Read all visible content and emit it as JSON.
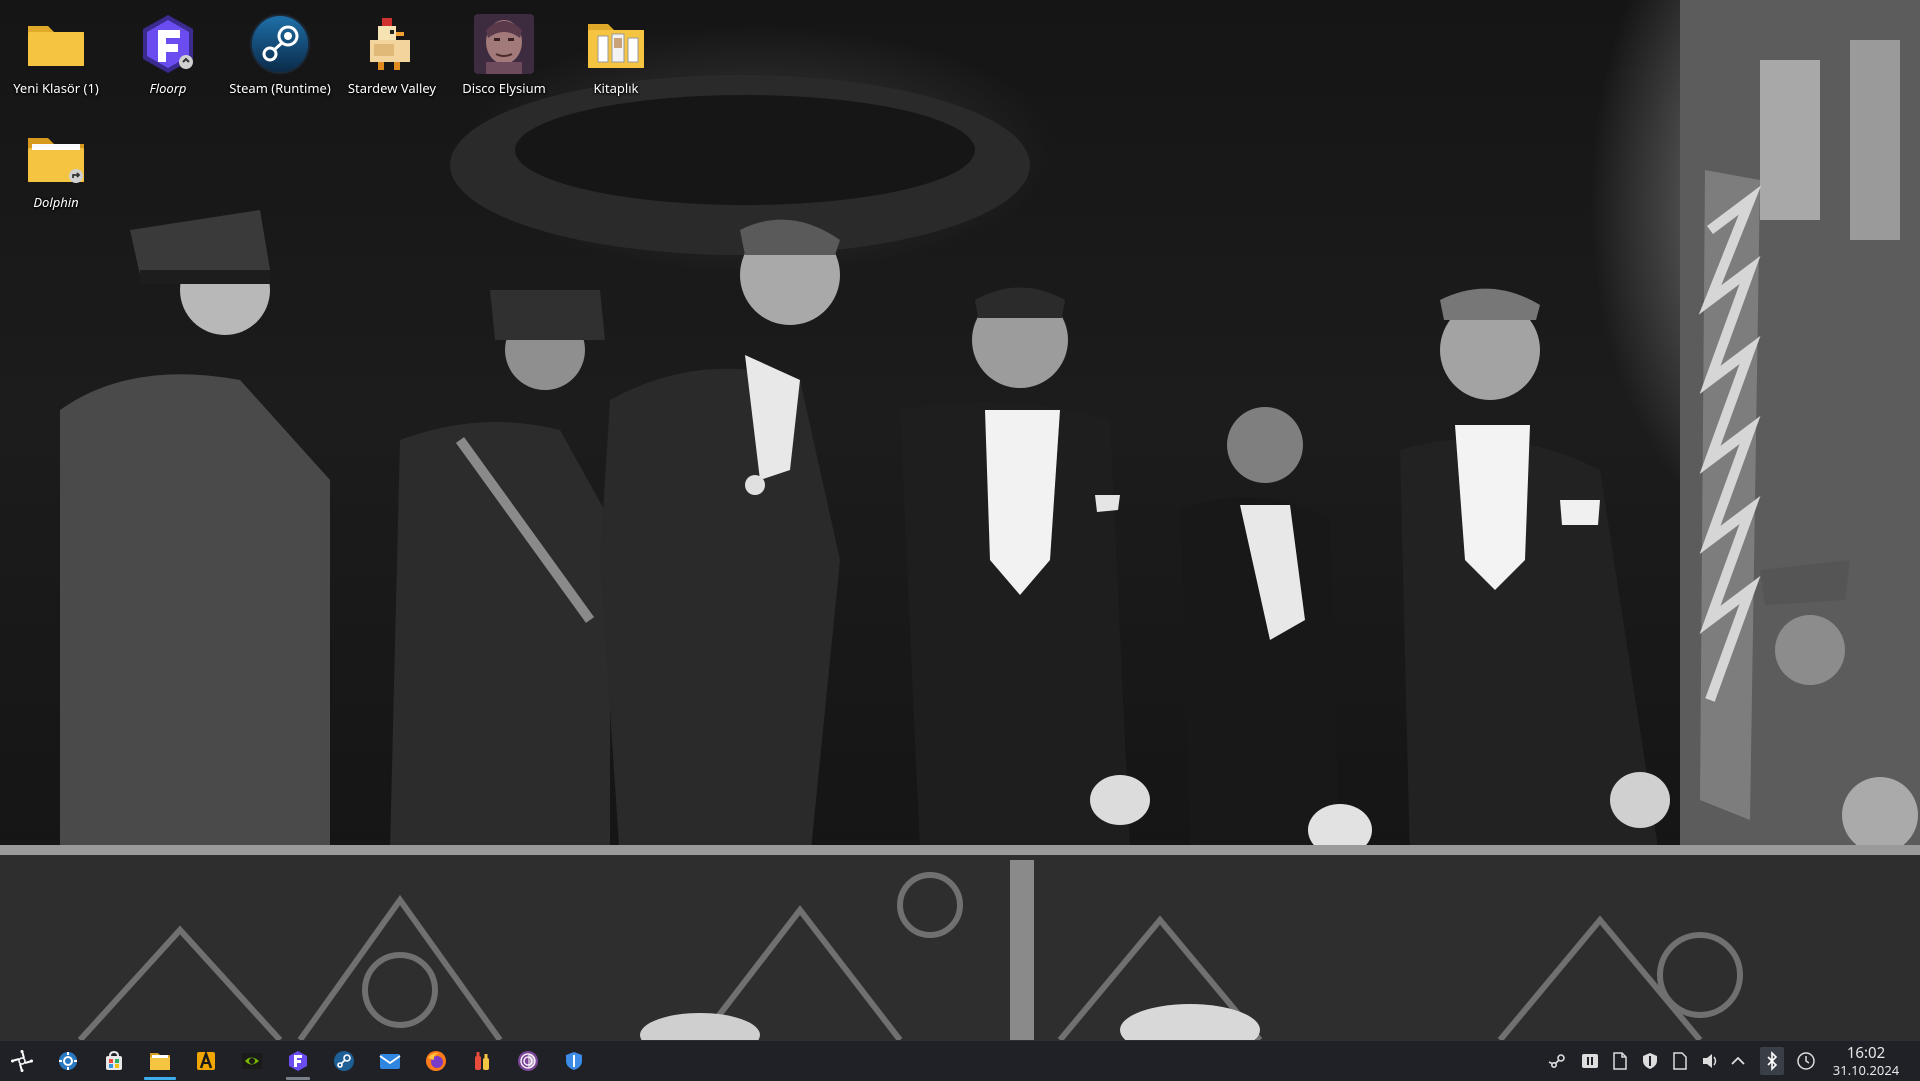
{
  "desktop": {
    "icons": [
      {
        "label": "Yeni Klasör (1)",
        "icon": "folder-icon"
      },
      {
        "label": "Floorp",
        "icon": "floorp-browser-icon"
      },
      {
        "label": "Steam (Runtime)",
        "icon": "steam-icon"
      },
      {
        "label": "Stardew Valley",
        "icon": "stardew-valley-chicken-icon"
      },
      {
        "label": "Disco Elysium",
        "icon": "disco-elysium-portrait-icon"
      },
      {
        "label": "Kitaplık",
        "icon": "library-folder-icon"
      },
      {
        "label": "Dolphin",
        "icon": "dolphin-folder-link-icon"
      }
    ]
  },
  "taskbar": {
    "launcher": {
      "icon": "kde-application-launcher-icon"
    },
    "pinned": [
      {
        "name": "System Settings",
        "icon": "system-settings-icon"
      },
      {
        "name": "Discover",
        "icon": "discover-store-icon"
      },
      {
        "name": "Dolphin",
        "icon": "dolphin-file-manager-icon",
        "state": "active"
      },
      {
        "name": "Lutris",
        "icon": "lutris-icon"
      },
      {
        "name": "NVIDIA Settings",
        "icon": "nvidia-icon"
      },
      {
        "name": "Floorp",
        "icon": "floorp-browser-icon",
        "state": "running"
      },
      {
        "name": "Steam",
        "icon": "steam-icon"
      },
      {
        "name": "Thunderbird",
        "icon": "thunderbird-mail-icon"
      },
      {
        "name": "Firefox",
        "icon": "firefox-icon"
      },
      {
        "name": "Bottles",
        "icon": "bottles-icon"
      },
      {
        "name": "Tor Browser",
        "icon": "tor-browser-icon"
      },
      {
        "name": "ProtonVPN",
        "icon": "protonvpn-shield-icon"
      }
    ],
    "tray": [
      {
        "icon": "steam-tray-icon"
      },
      {
        "icon": "media-pause-icon"
      },
      {
        "icon": "clipboard-icon"
      },
      {
        "icon": "shield-tray-icon"
      },
      {
        "icon": "document-tray-icon"
      },
      {
        "icon": "volume-icon"
      },
      {
        "icon": "chevron-up-icon"
      },
      {
        "icon": "bluetooth-icon"
      },
      {
        "icon": "update-status-icon"
      }
    ],
    "clock": {
      "time": "16:02",
      "date": "31.10.2024"
    }
  },
  "colors": {
    "taskbar_bg": "#1f2127",
    "accent": "#3daee9",
    "folder_yellow": "#f5c542"
  }
}
